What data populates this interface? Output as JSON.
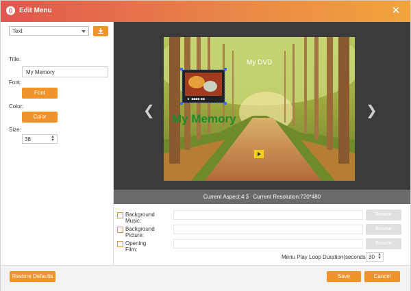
{
  "window": {
    "title": "Edit Menu",
    "close_icon": "close-icon"
  },
  "left": {
    "type_select": "Text",
    "title_label": "Title:",
    "title_value": "My Memory",
    "font_label": "Font:",
    "font_button": "Font",
    "color_label": "Color:",
    "color_button": "Color",
    "size_label": "Size:",
    "size_value": "38"
  },
  "preview": {
    "dvd_title": "My DVD",
    "memory_text": "My Memory",
    "thumb_caption": "► ■■■■ ■■"
  },
  "info": {
    "aspect": "Current Aspect:4:3",
    "resolution": "Current Resolution:720*480"
  },
  "options": {
    "bg_music": "Background Music:",
    "bg_picture": "Background Picture:",
    "opening_film": "Opening Film:",
    "browse": "Browse",
    "loop_label": "Menu Play Loop Duration(seconds):",
    "loop_value": "30"
  },
  "footer": {
    "restore": "Restore Defaults",
    "save": "Save",
    "cancel": "Cancel"
  },
  "colors": {
    "accent": "#f0932b",
    "title_gradient_start": "#e2564e",
    "memory_text": "#1f8a2b"
  }
}
